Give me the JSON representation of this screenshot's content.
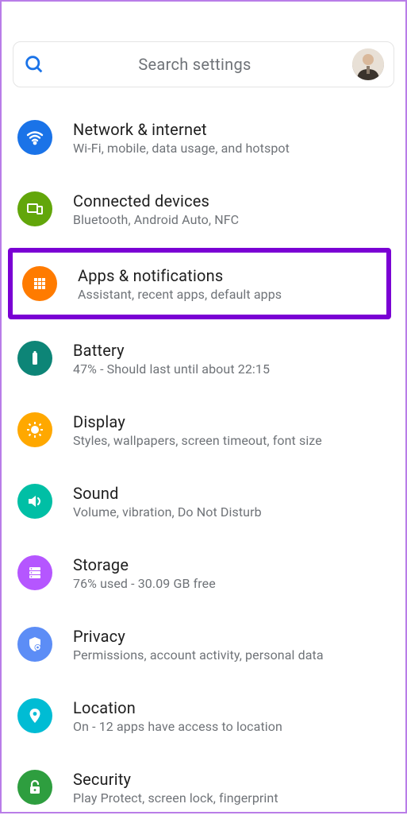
{
  "search": {
    "placeholder": "Search settings"
  },
  "items": [
    {
      "title": "Network & internet",
      "subtitle": "Wi-Fi, mobile, data usage, and hotspot"
    },
    {
      "title": "Connected devices",
      "subtitle": "Bluetooth, Android Auto, NFC"
    },
    {
      "title": "Apps & notifications",
      "subtitle": "Assistant, recent apps, default apps"
    },
    {
      "title": "Battery",
      "subtitle": "47% - Should last until about 22:15"
    },
    {
      "title": "Display",
      "subtitle": "Styles, wallpapers, screen timeout, font size"
    },
    {
      "title": "Sound",
      "subtitle": "Volume, vibration, Do Not Disturb"
    },
    {
      "title": "Storage",
      "subtitle": "76% used - 30.09 GB free"
    },
    {
      "title": "Privacy",
      "subtitle": "Permissions, account activity, personal data"
    },
    {
      "title": "Location",
      "subtitle": "On - 12 apps have access to location"
    },
    {
      "title": "Security",
      "subtitle": "Play Protect, screen lock, fingerprint"
    }
  ],
  "highlight_index": 2,
  "colors": {
    "highlight": "#7a00d4"
  }
}
